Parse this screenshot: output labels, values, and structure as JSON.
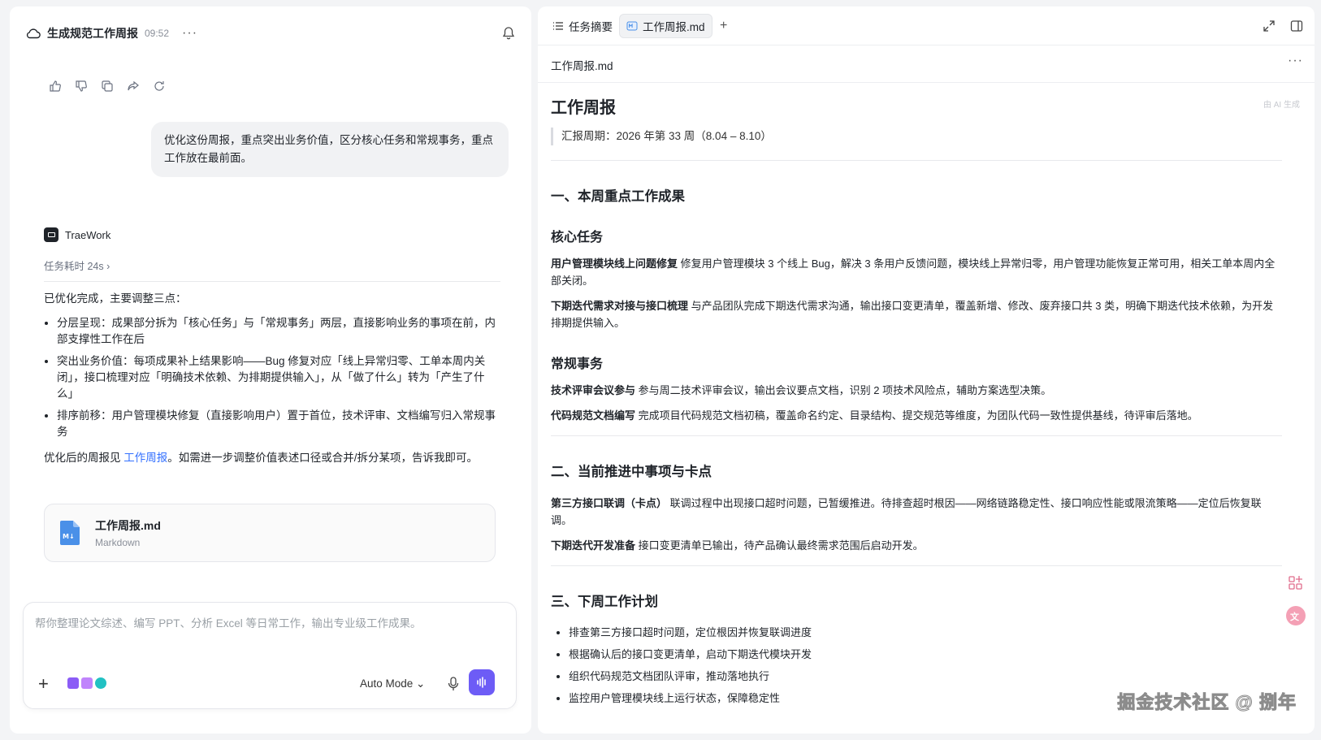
{
  "left": {
    "title": "生成规范工作周报",
    "time": "09:52",
    "more": "···",
    "user_message": "优化这份周报，重点突出业务价值，区分核心任务和常规事务，重点工作放在最前面。",
    "bot_name": "TraeWork",
    "task_time": "任务耗时 24s ›",
    "intro": "已优化完成，主要调整三点：",
    "bullets": [
      "分层呈现：成果部分拆为「核心任务」与「常规事务」两层，直接影响业务的事项在前，内部支撑性工作在后",
      "突出业务价值：每项成果补上结果影响——Bug 修复对应「线上异常归零、工单本周内关闭」，接口梳理对应「明确技术依赖、为排期提供输入」，从「做了什么」转为「产生了什么」",
      "排序前移：用户管理模块修复（直接影响用户）置于首位，技术评审、文档编写归入常规事务"
    ],
    "outro_before": "优化后的周报见 ",
    "outro_link": "工作周报",
    "outro_after": "。如需进一步调整价值表述口径或合并/拆分某项，告诉我即可。",
    "file_card": {
      "name": "工作周报.md",
      "type": "Markdown"
    },
    "composer": {
      "placeholder": "帮你整理论文综述、编写 PPT、分析 Excel 等日常工作，输出专业级工作成果。",
      "value": "",
      "mode": "Auto Mode ⌄"
    }
  },
  "right": {
    "tabs": [
      {
        "label": "任务摘要"
      },
      {
        "label": "工作周报.md"
      }
    ],
    "tab_add": "+",
    "doc_filename": "工作周报.md",
    "doc_more": "···",
    "ai_badge": "由 AI 生成",
    "doc": {
      "title": "工作周报",
      "period": "汇报周期：2026 年第 33 周（8.04 – 8.10）",
      "s1_title": "一、本周重点工作成果",
      "s1_core_title": "核心任务",
      "s1_core_1_label": "用户管理模块线上问题修复",
      "s1_core_1_text": " 修复用户管理模块 3 个线上 Bug，解决 3 条用户反馈问题，模块线上异常归零，用户管理功能恢复正常可用，相关工单本周内全部关闭。",
      "s1_core_2_label": "下期迭代需求对接与接口梳理",
      "s1_core_2_text": " 与产品团队完成下期迭代需求沟通，输出接口变更清单，覆盖新增、修改、废弃接口共 3 类，明确下期迭代技术依赖，为开发排期提供输入。",
      "s1_routine_title": "常规事务",
      "s1_routine_1_label": "技术评审会议参与",
      "s1_routine_1_text": " 参与周二技术评审会议，输出会议要点文档，识别 2 项技术风险点，辅助方案选型决策。",
      "s1_routine_2_label": "代码规范文档编写",
      "s1_routine_2_text": " 完成项目代码规范文档初稿，覆盖命名约定、目录结构、提交规范等维度，为团队代码一致性提供基线，待评审后落地。",
      "s2_title": "二、当前推进中事项与卡点",
      "s2_1_label": "第三方接口联调（卡点）",
      "s2_1_text": " 联调过程中出现接口超时问题，已暂缓推进。待排查超时根因——网络链路稳定性、接口响应性能或限流策略——定位后恢复联调。",
      "s2_2_label": "下期迭代开发准备",
      "s2_2_text": " 接口变更清单已输出，待产品确认最终需求范围后启动开发。",
      "s3_title": "三、下周工作计划",
      "s3_items": [
        "排查第三方接口超时问题，定位根因并恢复联调进度",
        "根据确认后的接口变更清单，启动下期迭代模块开发",
        "组织代码规范文档团队评审，推动落地执行",
        "监控用户管理模块线上运行状态，保障稳定性"
      ]
    }
  },
  "watermark": "掘金技术社区 @ 捌年",
  "colors": {
    "accent": "#6d5cf6",
    "link": "#3370ff"
  }
}
